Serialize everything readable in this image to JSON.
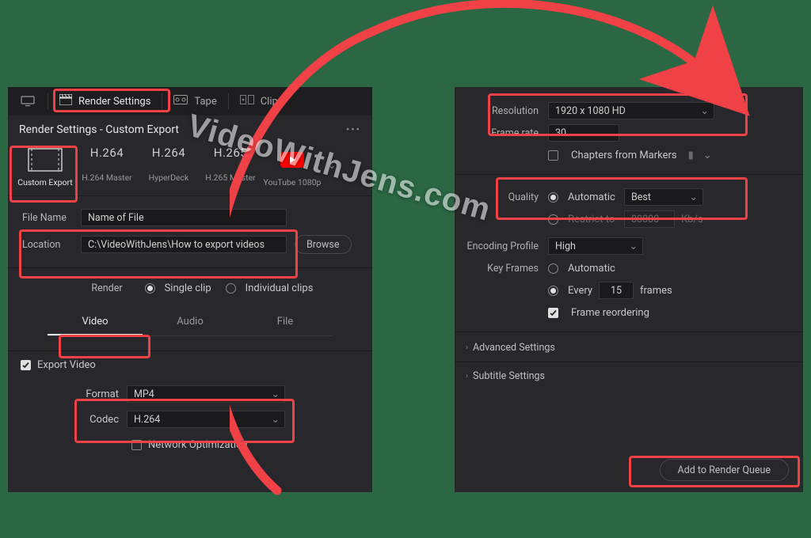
{
  "watermark_text": "VideoWithJens.com",
  "tabbar": {
    "render_settings": "Render Settings",
    "tape": "Tape",
    "clips": "Clips"
  },
  "subheader": {
    "title": "Render Settings - Custom Export"
  },
  "presets": {
    "custom": {
      "label": "Custom Export"
    },
    "h264m": {
      "title": "H.264",
      "sub": "H.264 Master"
    },
    "hyper": {
      "title": "H.264",
      "sub": "HyperDeck"
    },
    "h265m": {
      "title": "H.265",
      "sub": "H.265 Master"
    },
    "youtube": {
      "sub": "YouTube 1080p"
    }
  },
  "file": {
    "name_label": "File Name",
    "name_value": "Name of File",
    "location_label": "Location",
    "location_value": "C:\\VideoWithJens\\How to export videos",
    "browse": "Browse"
  },
  "render": {
    "label": "Render",
    "single": "Single clip",
    "individual": "Individual clips"
  },
  "segtabs": {
    "video": "Video",
    "audio": "Audio",
    "file": "File"
  },
  "export_video_label": "Export Video",
  "format": {
    "label": "Format",
    "value": "MP4"
  },
  "codec": {
    "label": "Codec",
    "value": "H.264"
  },
  "netopt": "Network Optimization",
  "right": {
    "resolution_label": "Resolution",
    "resolution_value": "1920 x 1080 HD",
    "framerate_label": "Frame rate",
    "framerate_value": "30",
    "chapters": "Chapters from Markers",
    "quality_label": "Quality",
    "quality_auto": "Automatic",
    "quality_best": "Best",
    "quality_restrict": "Restrict to",
    "quality_kb_value": "80000",
    "quality_kb_unit": "Kb/s",
    "encprofile_label": "Encoding Profile",
    "encprofile_value": "High",
    "keyframes_label": "Key Frames",
    "keyframes_auto": "Automatic",
    "keyframes_every": "Every",
    "keyframes_value": "15",
    "keyframes_unit": "frames",
    "frame_reorder": "Frame reordering",
    "advanced": "Advanced Settings",
    "subtitle": "Subtitle Settings",
    "add_queue": "Add to Render Queue"
  }
}
